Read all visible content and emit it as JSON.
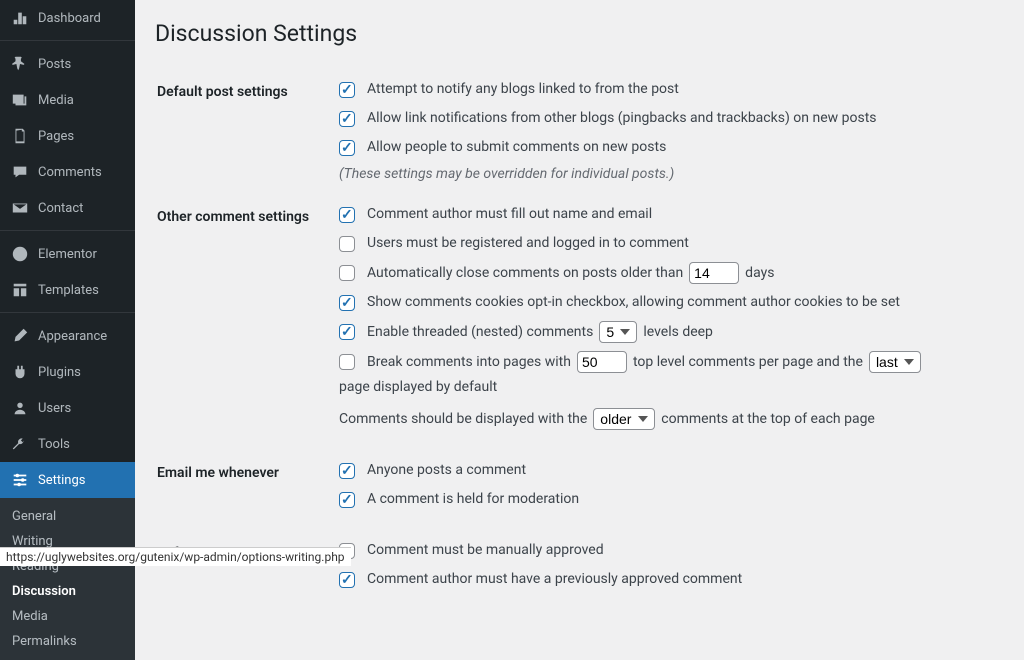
{
  "page": {
    "title": "Discussion Settings"
  },
  "sidebar": {
    "items": [
      {
        "label": "Dashboard",
        "icon": "dashboard"
      },
      {
        "label": "Posts",
        "icon": "pin"
      },
      {
        "label": "Media",
        "icon": "media"
      },
      {
        "label": "Pages",
        "icon": "pages"
      },
      {
        "label": "Comments",
        "icon": "comment"
      },
      {
        "label": "Contact",
        "icon": "mail"
      },
      {
        "label": "Elementor",
        "icon": "elementor"
      },
      {
        "label": "Templates",
        "icon": "templates"
      },
      {
        "label": "Appearance",
        "icon": "brush"
      },
      {
        "label": "Plugins",
        "icon": "plug"
      },
      {
        "label": "Users",
        "icon": "user"
      },
      {
        "label": "Tools",
        "icon": "wrench"
      },
      {
        "label": "Settings",
        "icon": "sliders",
        "current": true
      }
    ],
    "submenu": [
      {
        "label": "General"
      },
      {
        "label": "Writing"
      },
      {
        "label": "Reading"
      },
      {
        "label": "Discussion",
        "current": true
      },
      {
        "label": "Media"
      },
      {
        "label": "Permalinks"
      }
    ]
  },
  "sections": {
    "default_post": {
      "heading": "Default post settings",
      "attempt_notify": {
        "label": "Attempt to notify any blogs linked to from the post",
        "checked": true
      },
      "allow_pingback": {
        "label": "Allow link notifications from other blogs (pingbacks and trackbacks) on new posts",
        "checked": true
      },
      "allow_comments": {
        "label": "Allow people to submit comments on new posts",
        "checked": true
      },
      "note": "(These settings may be overridden for individual posts.)"
    },
    "other_comment": {
      "heading": "Other comment settings",
      "require_name_email": {
        "label": "Comment author must fill out name and email",
        "checked": true
      },
      "require_registered": {
        "label": "Users must be registered and logged in to comment",
        "checked": false
      },
      "auto_close": {
        "checked": false,
        "pre": "Automatically close comments on posts older than",
        "value": "14",
        "post": "days"
      },
      "cookies_optin": {
        "label": "Show comments cookies opt-in checkbox, allowing comment author cookies to be set",
        "checked": true
      },
      "threaded": {
        "checked": true,
        "pre": "Enable threaded (nested) comments",
        "value": "5",
        "post": "levels deep"
      },
      "paginate": {
        "checked": false,
        "pre": "Break comments into pages with",
        "per_page": "50",
        "mid": "top level comments per page and the",
        "default_page": "last",
        "post": "page displayed by default"
      },
      "order": {
        "pre": "Comments should be displayed with the",
        "value": "older",
        "post": "comments at the top of each page"
      }
    },
    "email_me": {
      "heading": "Email me whenever",
      "anyone_posts": {
        "label": "Anyone posts a comment",
        "checked": true
      },
      "held_moderation": {
        "label": "A comment is held for moderation",
        "checked": true
      }
    },
    "before_appears": {
      "heading": "Before a comment appears",
      "manual_approve": {
        "label": "Comment must be manually approved",
        "checked": false
      },
      "prev_approved": {
        "label": "Comment author must have a previously approved comment",
        "checked": true
      }
    }
  },
  "status_bar": "https://uglywebsites.org/gutenix/wp-admin/options-writing.php"
}
